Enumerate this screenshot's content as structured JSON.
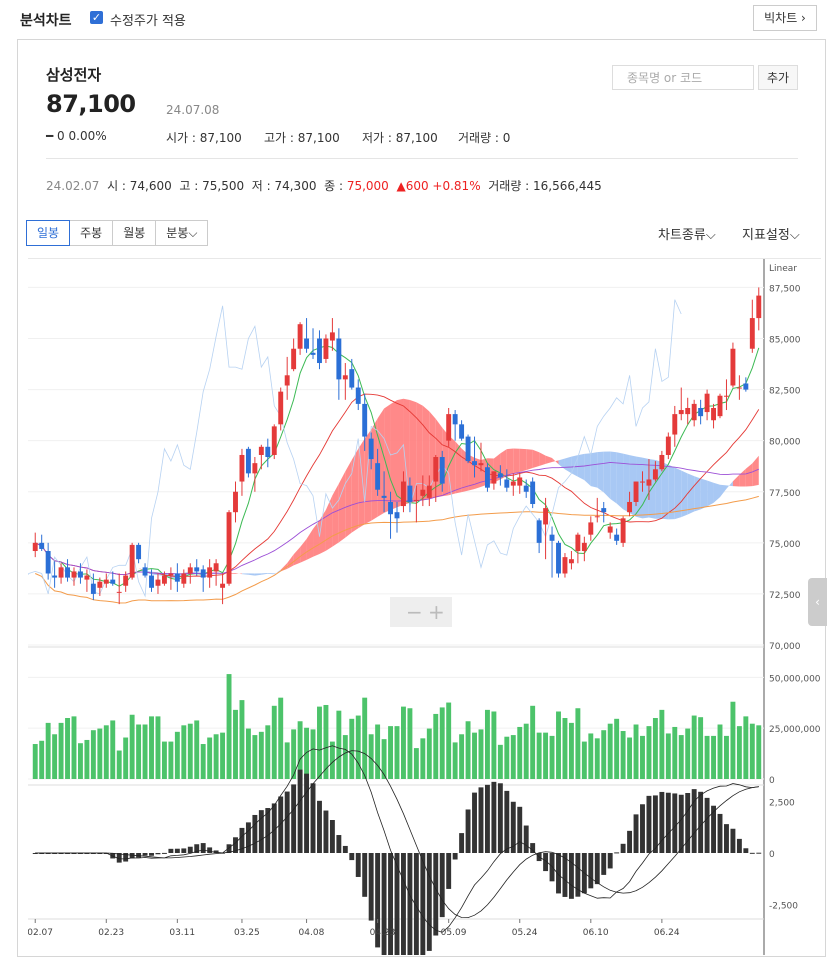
{
  "header": {
    "title": "분석차트",
    "check_label": "수정주가 적용",
    "big_chart_btn": "빅차트 ›"
  },
  "stock": {
    "name": "삼성전자",
    "price": "87,100",
    "date": "24.07.08",
    "change": "━ 0  0.00%",
    "stats": [
      {
        "label": "시가 : 87,100"
      },
      {
        "label": "고가 : 87,100"
      },
      {
        "label": "저가 : 87,100"
      },
      {
        "label": "거래량 : 0"
      }
    ]
  },
  "search": {
    "placeholder": "종목명 or 코드",
    "add_label": "추가"
  },
  "hover": {
    "date": "24.02.07",
    "open": "시 : 74,600",
    "high": "고 : 75,500",
    "low": "저 : 74,300",
    "close_label": "종 : ",
    "close": "75,000",
    "change": "▲600 +0.81%",
    "volume": "거래량 : 16,566,445"
  },
  "tabs": [
    "일봉",
    "주봉",
    "월봉",
    "분봉⌵"
  ],
  "right_tabs": {
    "chart_type": "차트종류⌵",
    "indicator": "지표설정⌵"
  },
  "colors": {
    "up": "#e43a3a",
    "down": "#2b6fd6",
    "volume": "#4cc36a"
  },
  "chart_data": {
    "type": "candlestick",
    "scale": "Linear",
    "price_ticks": [
      "87,500",
      "85,000",
      "82,500",
      "80,000",
      "77,500",
      "75,000",
      "72,500",
      "70,000"
    ],
    "price_range": [
      70000,
      88500
    ],
    "volume_ticks": [
      "50,000,000",
      "25,000,000",
      "0"
    ],
    "macd_ticks": [
      "2,500",
      "0",
      "-2,500"
    ],
    "x_labels": [
      "02.07",
      "02.23",
      "03.11",
      "03.25",
      "04.08",
      "04.23",
      "05.09",
      "05.24",
      "06.10",
      "06.24"
    ],
    "candles": [
      [
        74600,
        75500,
        74300,
        75000
      ],
      [
        75000,
        75400,
        74600,
        74700
      ],
      [
        74600,
        75000,
        73200,
        73500
      ],
      [
        73400,
        74100,
        72800,
        73300
      ],
      [
        73300,
        74000,
        73000,
        73800
      ],
      [
        73800,
        74200,
        73100,
        73300
      ],
      [
        73300,
        73800,
        72900,
        73600
      ],
      [
        73600,
        74000,
        73000,
        73300
      ],
      [
        73200,
        73700,
        72600,
        73400
      ],
      [
        73000,
        73500,
        72200,
        72500
      ],
      [
        72800,
        73300,
        72400,
        73100
      ],
      [
        73000,
        73500,
        72800,
        73200
      ],
      [
        73200,
        73600,
        72900,
        73000
      ],
      [
        72600,
        73500,
        72000,
        72600
      ],
      [
        72900,
        73600,
        72600,
        73400
      ],
      [
        73300,
        75000,
        73200,
        74900
      ],
      [
        74900,
        75000,
        74000,
        74200
      ],
      [
        73800,
        74000,
        73300,
        73400
      ],
      [
        73400,
        73700,
        72600,
        72800
      ],
      [
        72900,
        73500,
        72500,
        73200
      ],
      [
        73000,
        73600,
        72900,
        73400
      ],
      [
        73400,
        73800,
        72700,
        73500
      ],
      [
        73500,
        74000,
        72600,
        73100
      ],
      [
        73000,
        73700,
        72800,
        73500
      ],
      [
        73500,
        74000,
        73000,
        73800
      ],
      [
        73800,
        74200,
        73400,
        73600
      ],
      [
        73700,
        73900,
        72600,
        73300
      ],
      [
        73300,
        74200,
        72800,
        73800
      ],
      [
        73600,
        74200,
        72900,
        74000
      ],
      [
        72800,
        73500,
        72000,
        73000
      ],
      [
        73000,
        76600,
        72900,
        76500
      ],
      [
        76500,
        78000,
        76000,
        77500
      ],
      [
        78000,
        79600,
        77300,
        79300
      ],
      [
        79600,
        79700,
        78200,
        78400
      ],
      [
        78400,
        79200,
        77500,
        78900
      ],
      [
        79300,
        79800,
        78600,
        79700
      ],
      [
        79700,
        80100,
        78700,
        79200
      ],
      [
        79300,
        80800,
        79100,
        80700
      ],
      [
        80800,
        82600,
        80500,
        82400
      ],
      [
        82700,
        84100,
        82000,
        83200
      ],
      [
        83500,
        85000,
        83400,
        84500
      ],
      [
        84500,
        85800,
        84200,
        85700
      ],
      [
        85000,
        86000,
        84300,
        84500
      ],
      [
        84300,
        85500,
        84000,
        84200
      ],
      [
        85000,
        85400,
        83500,
        83800
      ],
      [
        84000,
        85200,
        83800,
        85000
      ],
      [
        84900,
        86000,
        84400,
        85300
      ],
      [
        85000,
        85500,
        82000,
        83000
      ],
      [
        83000,
        83800,
        82000,
        83200
      ],
      [
        83500,
        84000,
        82500,
        82600
      ],
      [
        82600,
        83000,
        81500,
        81800
      ],
      [
        81800,
        82300,
        79500,
        80200
      ],
      [
        80100,
        80400,
        78600,
        79100
      ],
      [
        78900,
        79600,
        77300,
        77600
      ],
      [
        77300,
        78500,
        76500,
        77200
      ],
      [
        77000,
        77500,
        75200,
        76400
      ],
      [
        76500,
        77000,
        75500,
        76200
      ],
      [
        76800,
        78500,
        76500,
        78000
      ],
      [
        77800,
        78200,
        76500,
        77000
      ],
      [
        77100,
        77800,
        76000,
        77100
      ],
      [
        77300,
        78300,
        76800,
        77600
      ],
      [
        77200,
        78300,
        76800,
        77800
      ],
      [
        78000,
        79300,
        77000,
        79200
      ],
      [
        79200,
        79500,
        77500,
        77900
      ],
      [
        80000,
        81600,
        79700,
        81300
      ],
      [
        81300,
        81500,
        80000,
        80800
      ],
      [
        80800,
        81000,
        80000,
        80100
      ],
      [
        80200,
        80300,
        78900,
        79000
      ],
      [
        79000,
        80200,
        78200,
        78800
      ],
      [
        78800,
        79900,
        78500,
        78900
      ],
      [
        78700,
        78900,
        77500,
        77700
      ],
      [
        77900,
        78500,
        77600,
        78500
      ],
      [
        78400,
        78800,
        77800,
        78200
      ],
      [
        78100,
        78600,
        77500,
        77700
      ],
      [
        77800,
        78400,
        77300,
        78000
      ],
      [
        77800,
        78400,
        77400,
        78200
      ],
      [
        77800,
        78100,
        77200,
        77500
      ],
      [
        78000,
        78200,
        76700,
        76900
      ],
      [
        76100,
        76200,
        74500,
        75000
      ],
      [
        75900,
        77200,
        74200,
        76700
      ],
      [
        75400,
        75800,
        73300,
        75100
      ],
      [
        75000,
        75100,
        73300,
        73500
      ],
      [
        73500,
        74500,
        73300,
        74300
      ],
      [
        74000,
        74600,
        73700,
        74200
      ],
      [
        74600,
        75500,
        74000,
        75400
      ],
      [
        74600,
        75300,
        74100,
        75000
      ],
      [
        75400,
        76300,
        75100,
        76000
      ],
      [
        76300,
        77200,
        76000,
        76300
      ],
      [
        76700,
        77000,
        76000,
        76500
      ],
      [
        75500,
        76000,
        75200,
        75800
      ],
      [
        75400,
        75700,
        74900,
        75100
      ],
      [
        75000,
        76300,
        74800,
        76200
      ],
      [
        76500,
        77500,
        76300,
        77000
      ],
      [
        77000,
        78000,
        76800,
        78000
      ],
      [
        78000,
        78500,
        77500,
        78000
      ],
      [
        77800,
        79100,
        77100,
        78100
      ],
      [
        78100,
        79000,
        78000,
        78600
      ],
      [
        78600,
        79500,
        78500,
        79300
      ],
      [
        79300,
        80400,
        79100,
        80200
      ],
      [
        80300,
        81700,
        79700,
        81300
      ],
      [
        81300,
        82600,
        81000,
        81500
      ],
      [
        81300,
        82100,
        80800,
        81600
      ],
      [
        81000,
        82000,
        80700,
        81800
      ],
      [
        81600,
        82000,
        80800,
        81200
      ],
      [
        81400,
        82500,
        81000,
        82300
      ],
      [
        81000,
        81800,
        80600,
        81600
      ],
      [
        81200,
        82300,
        81100,
        82200
      ],
      [
        82200,
        83000,
        81500,
        82200
      ],
      [
        82700,
        84800,
        82600,
        84500
      ],
      [
        82600,
        83200,
        82000,
        82600
      ],
      [
        82800,
        83100,
        82400,
        82500
      ],
      [
        84500,
        86900,
        84300,
        86000
      ],
      [
        86000,
        87500,
        85400,
        87100
      ]
    ]
  }
}
